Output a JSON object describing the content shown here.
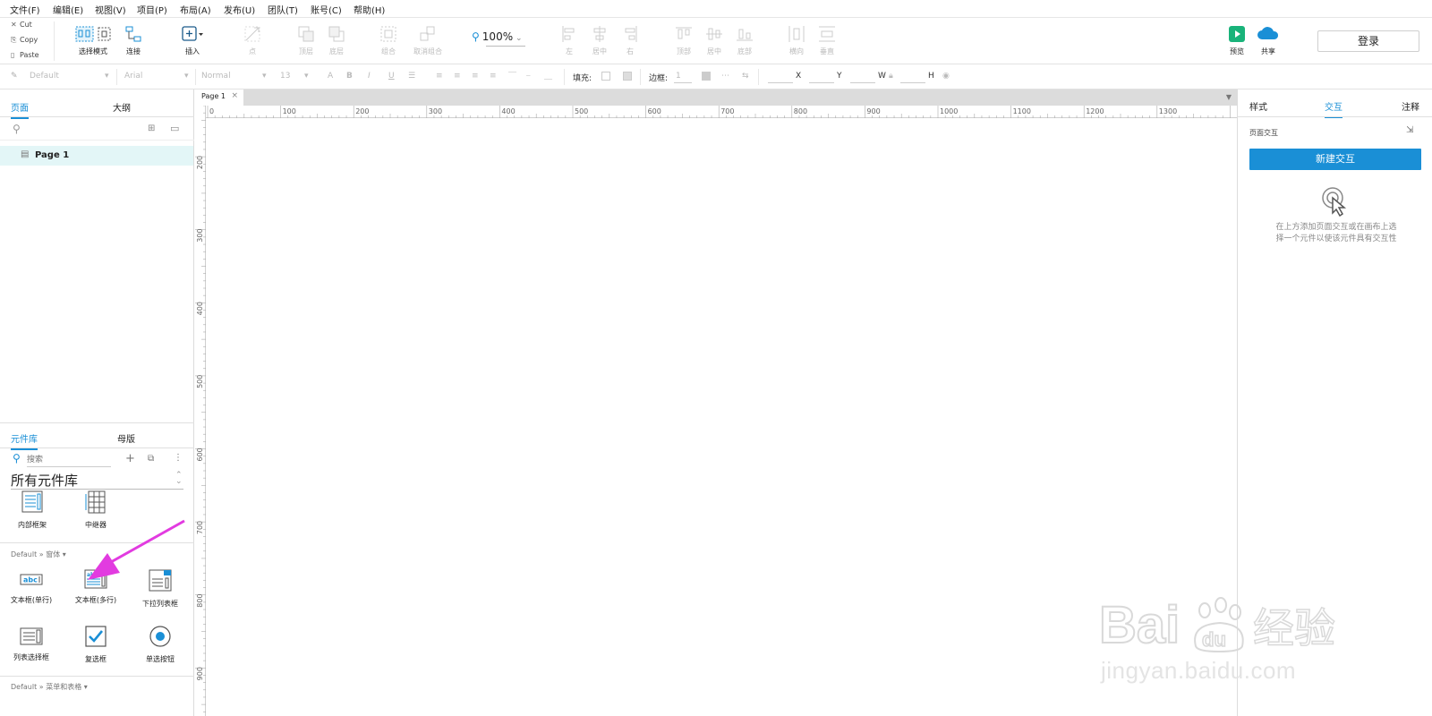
{
  "menubar": {
    "items": [
      "文件(F)",
      "编辑(E)",
      "视图(V)",
      "项目(P)",
      "布局(A)",
      "发布(U)",
      "团队(T)",
      "账号(C)",
      "帮助(H)"
    ]
  },
  "clipboard": {
    "cut": "Cut",
    "copy": "Copy",
    "paste": "Paste"
  },
  "toolbar": {
    "select_mode": "选择模式",
    "connect": "连接",
    "insert": "插入",
    "point": "点",
    "front": "顶层",
    "back": "底层",
    "group": "组合",
    "ungroup": "取消组合",
    "zoom": "100%",
    "align_left": "左",
    "align_center": "居中",
    "align_right": "右",
    "align_top": "顶部",
    "align_middle": "居中",
    "align_bottom": "底部",
    "dist_h": "横向",
    "dist_v": "垂直",
    "preview": "预览",
    "share": "共享",
    "login": "登录"
  },
  "formatbar": {
    "style": "Default",
    "font": "Arial",
    "weight": "Normal",
    "size": "13",
    "fill_label": "填充:",
    "border_label": "边框:",
    "border_value": "1",
    "x_label": "X",
    "y_label": "Y",
    "w_label": "W",
    "h_label": "H"
  },
  "left_panel": {
    "tabs": [
      "页面",
      "大纲"
    ],
    "pages": [
      {
        "label": "Page 1"
      }
    ],
    "library_tabs": [
      "元件库",
      "母版"
    ],
    "search_placeholder": "搜索",
    "library_select": "所有元件库",
    "widgets_top": [
      {
        "label": "内部框架",
        "icon": "inline-frame-icon"
      },
      {
        "label": "中继器",
        "icon": "repeater-icon"
      }
    ],
    "group_forms": "Default » 窗体 ▾",
    "widgets_forms": [
      {
        "label": "文本框(单行)",
        "icon": "text-field-icon"
      },
      {
        "label": "文本框(多行)",
        "icon": "text-area-icon"
      },
      {
        "label": "下拉列表框",
        "icon": "droplist-icon"
      },
      {
        "label": "列表选择框",
        "icon": "list-box-icon"
      },
      {
        "label": "复选框",
        "icon": "checkbox-icon"
      },
      {
        "label": "单选按钮",
        "icon": "radio-button-icon"
      }
    ],
    "group_menus": "Default » 菜单和表格 ▾"
  },
  "canvas": {
    "tab_label": "Page 1",
    "h_ruler_labels": [
      "0",
      "100",
      "200",
      "300",
      "400",
      "500",
      "600",
      "700",
      "800",
      "900",
      "1000",
      "1100",
      "1200",
      "1300"
    ],
    "v_ruler_labels": [
      "200",
      "300",
      "400",
      "500",
      "600",
      "700",
      "800",
      "900"
    ]
  },
  "right_panel": {
    "tabs": [
      "样式",
      "交互",
      "注释"
    ],
    "section_title": "页面交互",
    "new_interaction": "新建交互",
    "hint": "在上方添加页面交互或在画布上选择一个元件以使该元件具有交互性"
  },
  "watermark": {
    "brand": "Bai",
    "brand_suffix": "du",
    "product": "经验",
    "url": "jingyan.baidu.com"
  },
  "colors": {
    "accent": "#1a8fd6",
    "selected_row": "#e3f6f7",
    "annotation_arrow": "#e23be0",
    "preview_green": "#19b37a"
  }
}
